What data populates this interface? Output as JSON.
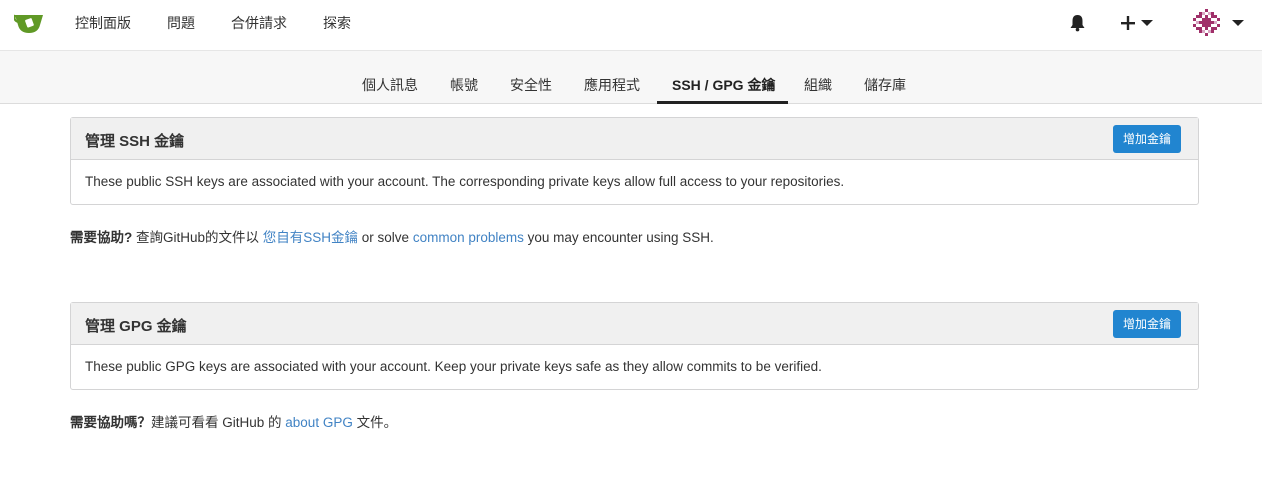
{
  "nav": {
    "items": [
      "控制面版",
      "問題",
      "合併請求",
      "探索"
    ]
  },
  "settings_tabs": {
    "items": [
      "個人訊息",
      "帳號",
      "安全性",
      "應用程式",
      "SSH / GPG 金鑰",
      "組織",
      "儲存庫"
    ],
    "active": "SSH / GPG 金鑰"
  },
  "ssh": {
    "title": "管理 SSH 金鑰",
    "add_label": "增加金鑰",
    "description": "These public SSH keys are associated with your account. The corresponding private keys allow full access to your repositories.",
    "help_bold": "需要協助?",
    "help_text1": " 查詢GitHub的文件以 ",
    "help_link1": "您自有SSH金鑰",
    "help_text2": " or solve ",
    "help_link2": "common problems",
    "help_text3": " you may encounter using SSH."
  },
  "gpg": {
    "title": "管理 GPG 金鑰",
    "add_label": "增加金鑰",
    "description": "These public GPG keys are associated with your account. Keep your private keys safe as they allow commits to be verified.",
    "help_bold": "需要協助嗎？",
    "help_text1": "建議可看看 GitHub 的 ",
    "help_link": "about GPG",
    "help_text2": " 文件。"
  },
  "colors": {
    "primary_button": "#2185d0",
    "link": "#4183c4",
    "logo_green": "#609926"
  },
  "icons": [
    "gitea-logo-icon",
    "bell-icon",
    "plus-icon",
    "caret-down-icon",
    "avatar-identicon"
  ]
}
